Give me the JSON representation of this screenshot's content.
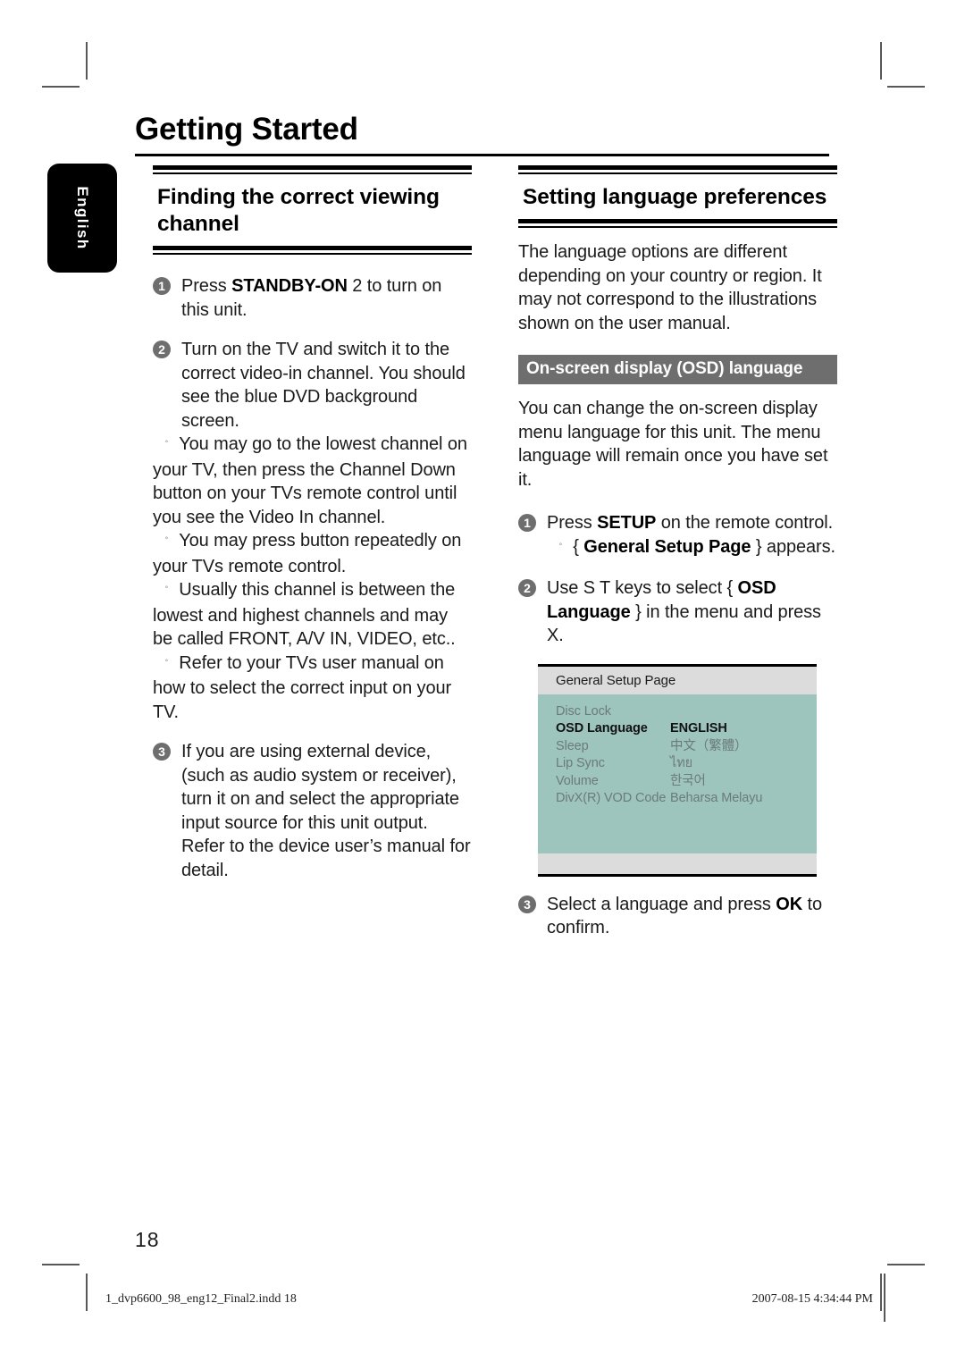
{
  "page": {
    "chapter_title": "Getting Started",
    "language_tab": "English",
    "page_number": "18"
  },
  "left_column": {
    "section_title": "Finding the correct viewing channel",
    "steps": [
      {
        "number": "1",
        "parts": [
          {
            "text": "Press ",
            "bold": false
          },
          {
            "text": "STANDBY-ON",
            "bold": true
          },
          {
            "text": " 2   to turn on this unit.",
            "bold": false
          }
        ],
        "sub_items": []
      },
      {
        "number": "2",
        "parts": [
          {
            "text": "Turn on the TV and switch it to the correct video-in channel. You should see the blue DVD background screen.",
            "bold": false
          }
        ],
        "sub_items": [
          "You may go to the lowest channel on your TV, then press the Channel Down button on your TVs remote control until you see the Video In channel.",
          "You may press      button repeatedly on your TVs remote control.",
          "Usually this channel is between the lowest and highest channels and may be called FRONT, A/V IN, VIDEO, etc..",
          "Refer to your TVs user manual on how to select the correct input on your TV."
        ]
      },
      {
        "number": "3",
        "parts": [
          {
            "text": "If you are using external device, (such as audio system or receiver), turn it on and select the appropriate input source for this unit output. Refer to the device user’s manual for detail.",
            "bold": false
          }
        ],
        "sub_items": []
      }
    ]
  },
  "right_column": {
    "section_title": "Setting language preferences",
    "intro": "The language options are different depending on your country or region. It may not correspond to the illustrations shown on the user manual.",
    "subsection_bar": "On-screen display (OSD) language",
    "subsection_intro": "You can change the on-screen display menu language for this unit. The menu language will remain once you have set it.",
    "steps": [
      {
        "number": "1",
        "parts": [
          {
            "text": "Press ",
            "bold": false
          },
          {
            "text": "SETUP",
            "bold": true
          },
          {
            "text": " on the remote control.",
            "bold": false
          }
        ],
        "sub_items_rich": [
          [
            {
              "text": "{ ",
              "bold": false
            },
            {
              "text": "General Setup Page",
              "bold": true
            },
            {
              "text": " } appears.",
              "bold": false
            }
          ]
        ]
      },
      {
        "number": "2",
        "parts": [
          {
            "text": "Use  S T keys to select { ",
            "bold": false
          },
          {
            "text": "OSD Language",
            "bold": true
          },
          {
            "text": " } in the menu and press  X.",
            "bold": false
          }
        ],
        "sub_items_rich": []
      },
      {
        "number": "3",
        "parts": [
          {
            "text": "Select a language and press ",
            "bold": false
          },
          {
            "text": "OK",
            "bold": true
          },
          {
            "text": " to confirm.",
            "bold": false
          }
        ],
        "sub_items_rich": []
      }
    ]
  },
  "osd_screenshot": {
    "title": "General Setup Page",
    "rows": [
      {
        "label": "Disc Lock",
        "value": "",
        "active": false
      },
      {
        "label": "OSD Language",
        "value": "ENGLISH",
        "active": true
      },
      {
        "label": "Sleep",
        "value": "中文（繁體）",
        "active": false
      },
      {
        "label": "Lip Sync",
        "value": "ไทย",
        "active": false
      },
      {
        "label": "Volume",
        "value": "한국어",
        "active": false
      },
      {
        "label": "DivX(R) VOD Code",
        "value": "Beharsa Melayu",
        "active": false
      }
    ]
  },
  "footer": {
    "file_name": "1_dvp6600_98_eng12_Final2.indd   18",
    "timestamp": "2007-08-15   4:34:44 PM"
  },
  "colors": {
    "osd_body": "#9ec4be",
    "osd_chrome": "#dcdcdc",
    "gray_bar": "#6e6e6e",
    "step_bullet": "#6e6e6e",
    "tab_background": "#000000",
    "crop_mark": "#58585a"
  }
}
